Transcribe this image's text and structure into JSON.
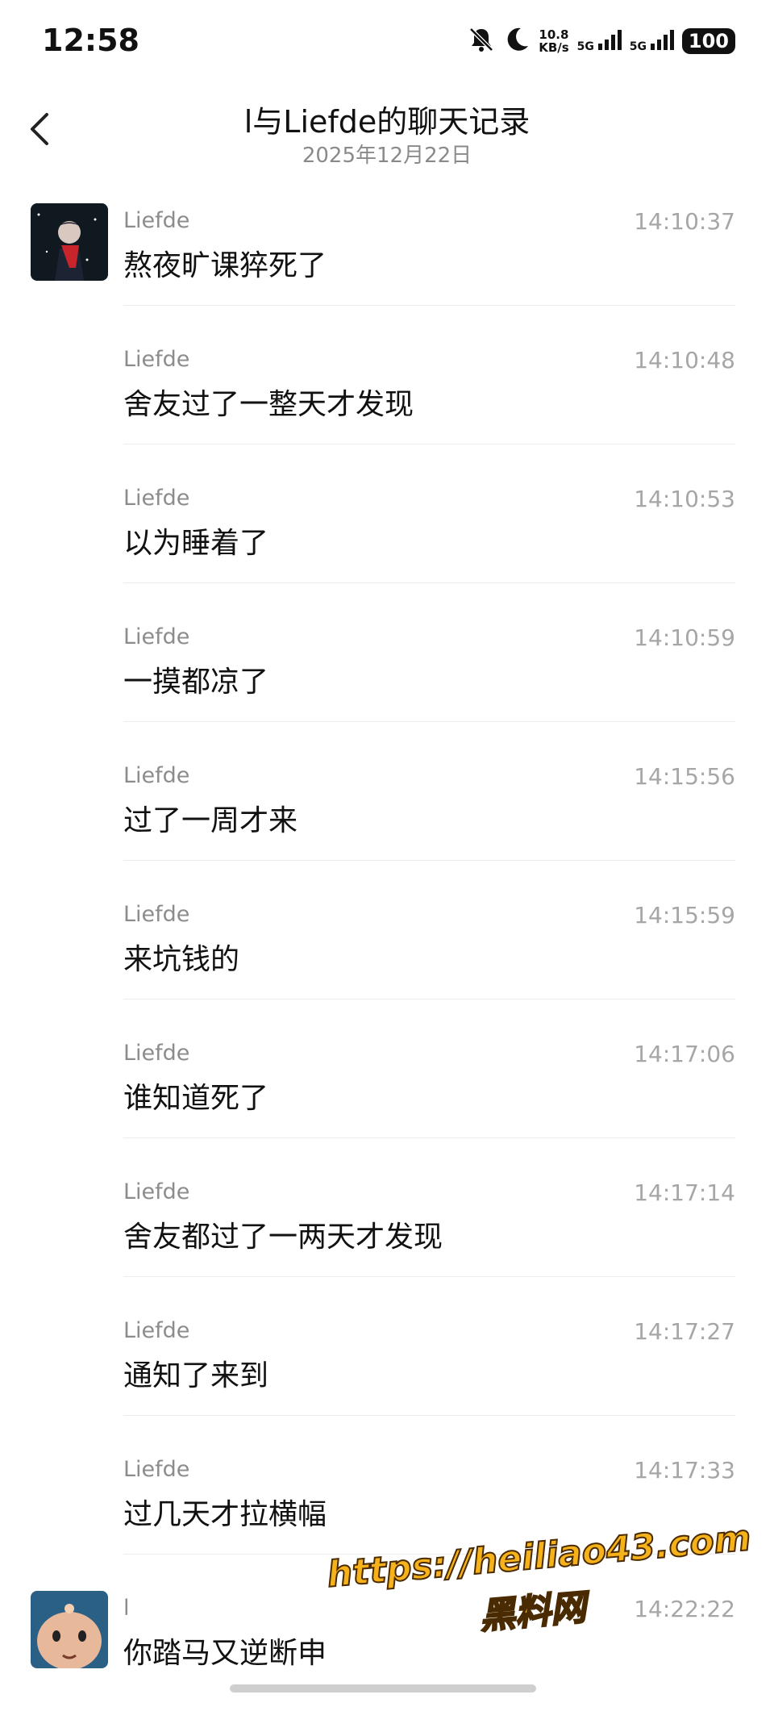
{
  "status_bar": {
    "time": "12:58",
    "speed_value": "10.8",
    "speed_unit": "KB/s",
    "net1": "5G",
    "net2": "5G",
    "battery": "100"
  },
  "header": {
    "title": "l与Liefde的聊天记录",
    "date": "2025年12月22日"
  },
  "messages": [
    {
      "sender": "Liefde",
      "time": "14:10:37",
      "text": "熬夜旷课猝死了",
      "avatar": true
    },
    {
      "sender": "Liefde",
      "time": "14:10:48",
      "text": "舍友过了一整天才发现"
    },
    {
      "sender": "Liefde",
      "time": "14:10:53",
      "text": "以为睡着了"
    },
    {
      "sender": "Liefde",
      "time": "14:10:59",
      "text": "一摸都凉了"
    },
    {
      "sender": "Liefde",
      "time": "14:15:56",
      "text": "过了一周才来"
    },
    {
      "sender": "Liefde",
      "time": "14:15:59",
      "text": "来坑钱的"
    },
    {
      "sender": "Liefde",
      "time": "14:17:06",
      "text": "谁知道死了"
    },
    {
      "sender": "Liefde",
      "time": "14:17:14",
      "text": "舍友都过了一两天才发现"
    },
    {
      "sender": "Liefde",
      "time": "14:17:27",
      "text": "通知了来到"
    },
    {
      "sender": "Liefde",
      "time": "14:17:33",
      "text": "过几天才拉横幅"
    },
    {
      "sender": "l",
      "time": "14:22:22",
      "text": "你踏马又逆断申",
      "avatar": true
    }
  ],
  "watermark": {
    "line1": "https://heiliao43.com",
    "line2": "黑料网"
  }
}
